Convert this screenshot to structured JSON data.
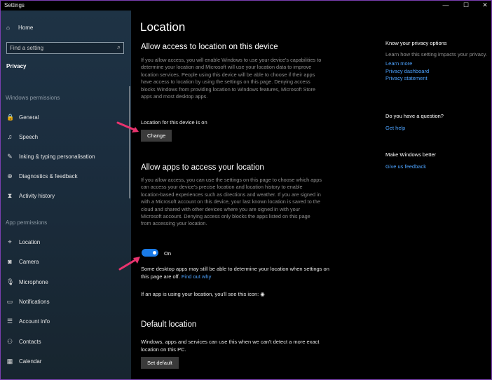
{
  "window": {
    "title": "Settings",
    "minimize_glyph": "—",
    "maximize_glyph": "☐",
    "close_glyph": "✕"
  },
  "sidebar": {
    "home": "Home",
    "search_placeholder": "Find a setting",
    "category": "Privacy",
    "sections": {
      "windows_permissions": "Windows permissions",
      "app_permissions": "App permissions"
    },
    "items": [
      {
        "label": "General",
        "icon": "lock-icon",
        "glyph": "🔒"
      },
      {
        "label": "Speech",
        "icon": "speech-icon",
        "glyph": "♫"
      },
      {
        "label": "Inking & typing personalisation",
        "icon": "inking-icon",
        "glyph": "✎"
      },
      {
        "label": "Diagnostics & feedback",
        "icon": "diagnostics-icon",
        "glyph": "⊕"
      },
      {
        "label": "Activity history",
        "icon": "activity-icon",
        "glyph": "⧗"
      },
      {
        "label": "Location",
        "icon": "location-icon",
        "glyph": "⌖"
      },
      {
        "label": "Camera",
        "icon": "camera-icon",
        "glyph": "◙"
      },
      {
        "label": "Microphone",
        "icon": "microphone-icon",
        "glyph": "🎙"
      },
      {
        "label": "Notifications",
        "icon": "notifications-icon",
        "glyph": "▭"
      },
      {
        "label": "Account info",
        "icon": "account-info-icon",
        "glyph": "☰"
      },
      {
        "label": "Contacts",
        "icon": "contacts-icon",
        "glyph": "⚇"
      },
      {
        "label": "Calendar",
        "icon": "calendar-icon",
        "glyph": "▦"
      }
    ]
  },
  "main": {
    "title": "Location",
    "allow_device": {
      "heading": "Allow access to location on this device",
      "description": "If you allow access, you will enable Windows to use your device's capabilities to determine your location and Microsoft will use your location data to improve location services. People using this device will be able to choose if their apps have access to location by using the settings on this page. Denying access blocks Windows from providing location to Windows features, Microsoft Store apps and most desktop apps.",
      "status": "Location for this device is on",
      "button": "Change"
    },
    "allow_apps": {
      "heading": "Allow apps to access your location",
      "description": "If you allow access, you can use the settings on this page to choose which apps can access your device's precise location and location history to enable location-based experiences such as directions and weather. If you are signed in with a Microsoft account on this device, your last known location is saved to the cloud and shared with other devices where you are signed in with your Microsoft account. Denying access only blocks the apps listed on this page from accessing your location.",
      "toggle_state": "On",
      "toggle_on": true,
      "note": "Some desktop apps may still be able to determine your location when settings on this page are off.",
      "note_link": "Find out why",
      "icon_note": "If an app is using your location, you'll see this icon:"
    },
    "default_location": {
      "heading": "Default location",
      "description": "Windows, apps and services can use this when we can't detect a more exact location on this PC.",
      "button": "Set default"
    }
  },
  "right": {
    "privacy_options": {
      "heading": "Know your privacy options",
      "text": "Learn how this setting impacts your privacy.",
      "links": [
        "Learn more",
        "Privacy dashboard",
        "Privacy statement"
      ]
    },
    "question": {
      "heading": "Do you have a question?",
      "link": "Get help"
    },
    "better": {
      "heading": "Make Windows better",
      "link": "Give us feedback"
    }
  },
  "colors": {
    "accent": "#1a7be8",
    "link": "#4da3ff",
    "annotation_arrow": "#e8336e"
  }
}
